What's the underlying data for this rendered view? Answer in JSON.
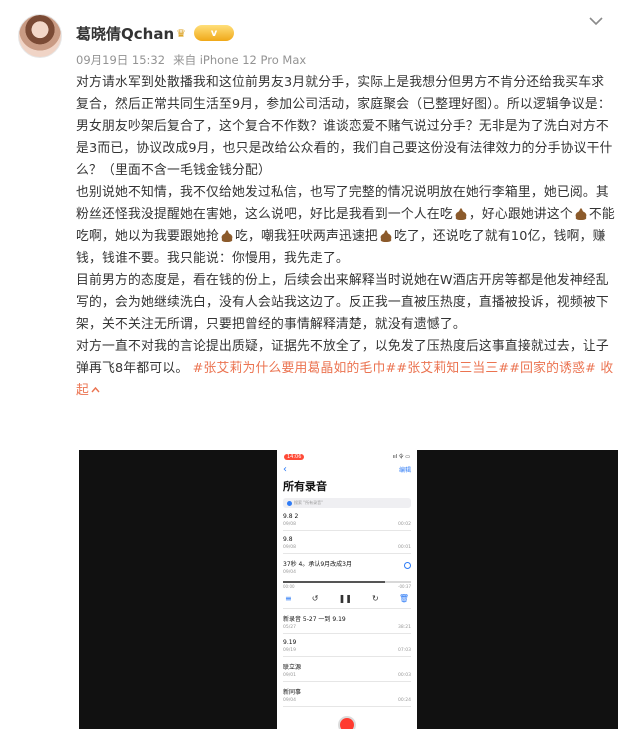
{
  "user": {
    "name": "葛晓倩Qchan",
    "vip_label": "ⅴ",
    "date": "09月19日 15:32",
    "source": "来自 iPhone 12 Pro Max"
  },
  "post": {
    "p1": "对方请水军到处散播我和这位前男友3月就分手，实际上是我想分但男方不肯分还给我买车求复合，然后正常共同生活至9月，参加公司活动，家庭聚会（已整理好图）。所以逻辑争议是：男女朋友吵架后复合了，这个复合不作数？谁谈恋爱不赌气说过分手？无非是为了洗白对方不是3而已，协议改成9月，也只是改给公众看的，我们自己要这份没有法律效力的分手协议干什么？（里面不含一毛钱金钱分配）",
    "p2a": "也别说她不知情，我不仅给她发过私信，也写了完整的情况说明放在她行李箱里，她已阅。其粉丝还怪我没提醒她在害她，这么说吧，好比是我看到一个人在吃",
    "p2b": "，好心跟她讲这个",
    "p2c": "不能吃啊，她以为我要跟她抢",
    "p2d": "吃，嘲我狂吠两声迅速把",
    "p2e": "吃了，还说吃了就有10亿，钱啊，赚钱，钱谁不要。我只能说：你慢用，我先走了。",
    "p3": "目前男方的态度是，看在钱的份上，后续会出来解释当时说她在W酒店开房等都是他发神经乱写的，会为她继续洗白，没有人会站我这边了。反正我一直被压热度，直播被投诉，视频被下架，关不关注无所谓，只要把曾经的事情解释清楚，就没有遗憾了。",
    "p4": "对方一直不对我的言论提出质疑，证据先不放全了，以免发了压热度后这事直接就过去，让子弹再飞8年都可以。",
    "hashtags": [
      "#张艾莉为什么要用葛晶如的毛巾#",
      "#张艾莉知三当三#",
      "#回家的诱惑#"
    ],
    "collapse": "收起",
    "collapse_icon": "chevron-up-icon"
  },
  "phone": {
    "status_time": "14:06",
    "status_icons": "ııl 令 ▭",
    "back": "‹",
    "edit": "编辑",
    "title": "所有录音",
    "search_placeholder": "搜索 \"所有录音\"",
    "recordings": [
      {
        "name": "9.8 2",
        "date": "09/08",
        "duration": "00:02"
      },
      {
        "name": "9.8",
        "date": "09/08",
        "duration": "00:01"
      }
    ],
    "active": {
      "name": "37秒 4。承认9月改成3月",
      "date": "09/04",
      "elapsed": "00:00",
      "remaining": "-00:37",
      "progress": 0.8
    },
    "recordings2": [
      {
        "name": "新录音 5-27 一到 9.19",
        "date": "05/27",
        "duration": "38:21"
      },
      {
        "name": "9.19",
        "date": "09/19",
        "duration": "07:03"
      },
      {
        "name": "联立源",
        "date": "09/01",
        "duration": "00:03"
      },
      {
        "name": "新同事",
        "date": "09/04",
        "duration": "00:24"
      }
    ]
  }
}
